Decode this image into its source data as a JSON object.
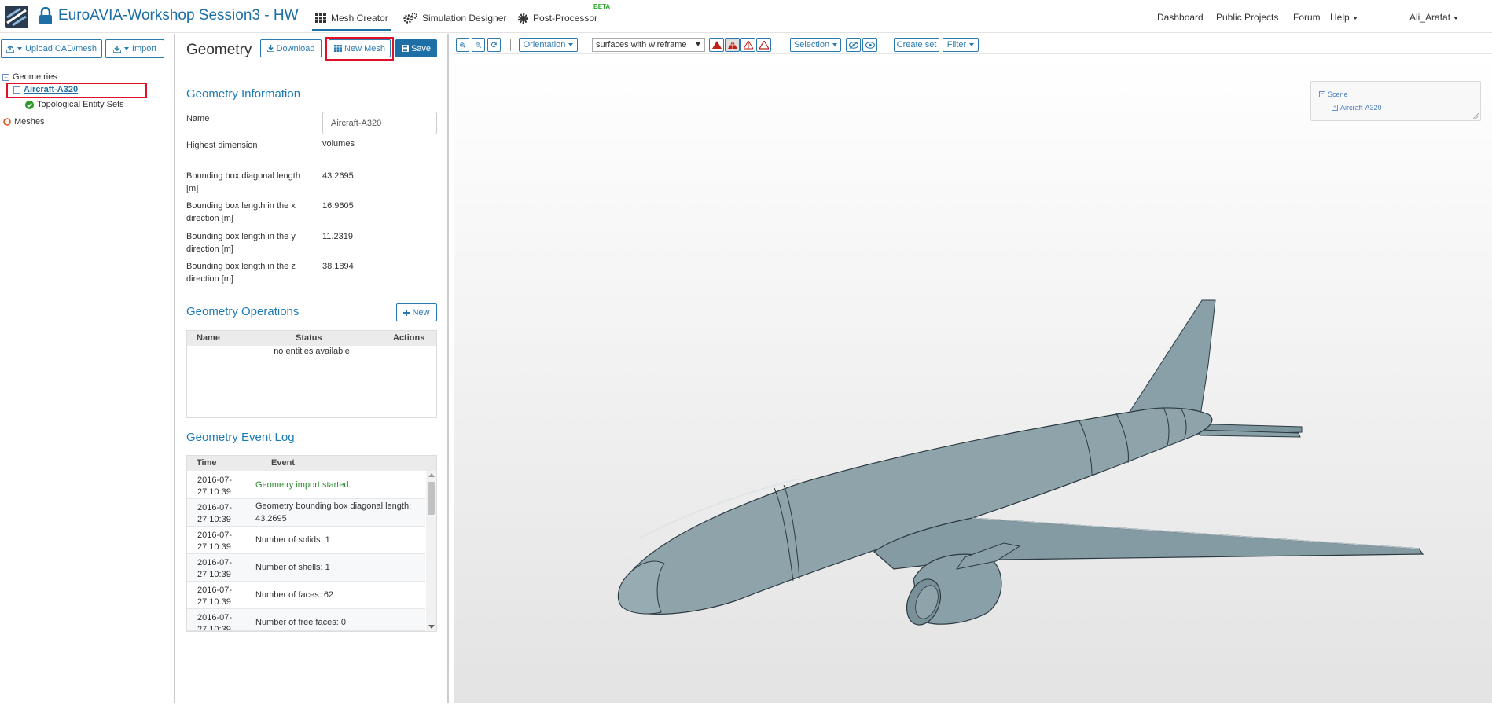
{
  "app": {
    "project_title": "EuroAVIA-Workshop Session3 - HW",
    "tabs": [
      {
        "label": "Mesh Creator",
        "active": true
      },
      {
        "label": "Simulation Designer",
        "active": false
      },
      {
        "label": "Post-Processor",
        "active": false
      }
    ],
    "beta_badge": "BETA",
    "right_nav": [
      "Dashboard",
      "Public Projects",
      "Forum",
      "Help"
    ],
    "user": "Ali_Arafat",
    "accent_color": "#1d6fa5"
  },
  "left": {
    "upload_label": "Upload CAD/mesh",
    "import_label": "Import",
    "tree": {
      "geometries": "Geometries",
      "selected_geometry": "Aircraft-A320",
      "topo_sets": "Topological Entity Sets",
      "meshes": "Meshes"
    }
  },
  "middle": {
    "title": "Geometry",
    "download_label": "Download",
    "new_mesh_label": "New Mesh",
    "save_label": "Save",
    "info_title": "Geometry Information",
    "name_label": "Name",
    "name_value": "Aircraft-A320",
    "props": [
      {
        "label": "Highest dimension",
        "value": "volumes"
      },
      {
        "label": "Bounding box diagonal length [m]",
        "value": "43.2695"
      },
      {
        "label": "Bounding box length in the x direction [m]",
        "value": "16.9605"
      },
      {
        "label": "Bounding box length in the y direction [m]",
        "value": "11.2319"
      },
      {
        "label": "Bounding box length in the z direction [m]",
        "value": "38.1894"
      }
    ],
    "operations": {
      "title": "Geometry Operations",
      "new_label": "New",
      "columns": [
        "Name",
        "Status",
        "Actions"
      ],
      "empty_text": "no entities available"
    },
    "event_log": {
      "title": "Geometry Event Log",
      "columns": [
        "Time",
        "Event"
      ],
      "rows": [
        {
          "time": "2016-07-27 10:39",
          "event": "Geometry import started.",
          "color": "#2e8b2e"
        },
        {
          "time": "2016-07-27 10:39",
          "event": "Geometry bounding box diagonal length: 43.2695",
          "color": "#333333"
        },
        {
          "time": "2016-07-27 10:39",
          "event": "Number of solids: 1",
          "color": "#333333"
        },
        {
          "time": "2016-07-27 10:39",
          "event": "Number of shells: 1",
          "color": "#333333"
        },
        {
          "time": "2016-07-27 10:39",
          "event": "Number of faces: 62",
          "color": "#333333"
        },
        {
          "time": "2016-07-27 10:39",
          "event": "Number of free faces: 0",
          "color": "#333333"
        }
      ]
    }
  },
  "viewer": {
    "orientation_label": "Orientation",
    "render_mode": "surfaces with wireframe",
    "selection_label": "Selection",
    "create_set_label": "Create set",
    "filter_label": "Filter",
    "scene_label": "Scene",
    "scene_item": "Aircraft-A320",
    "model_color": "#8fa3ab"
  }
}
